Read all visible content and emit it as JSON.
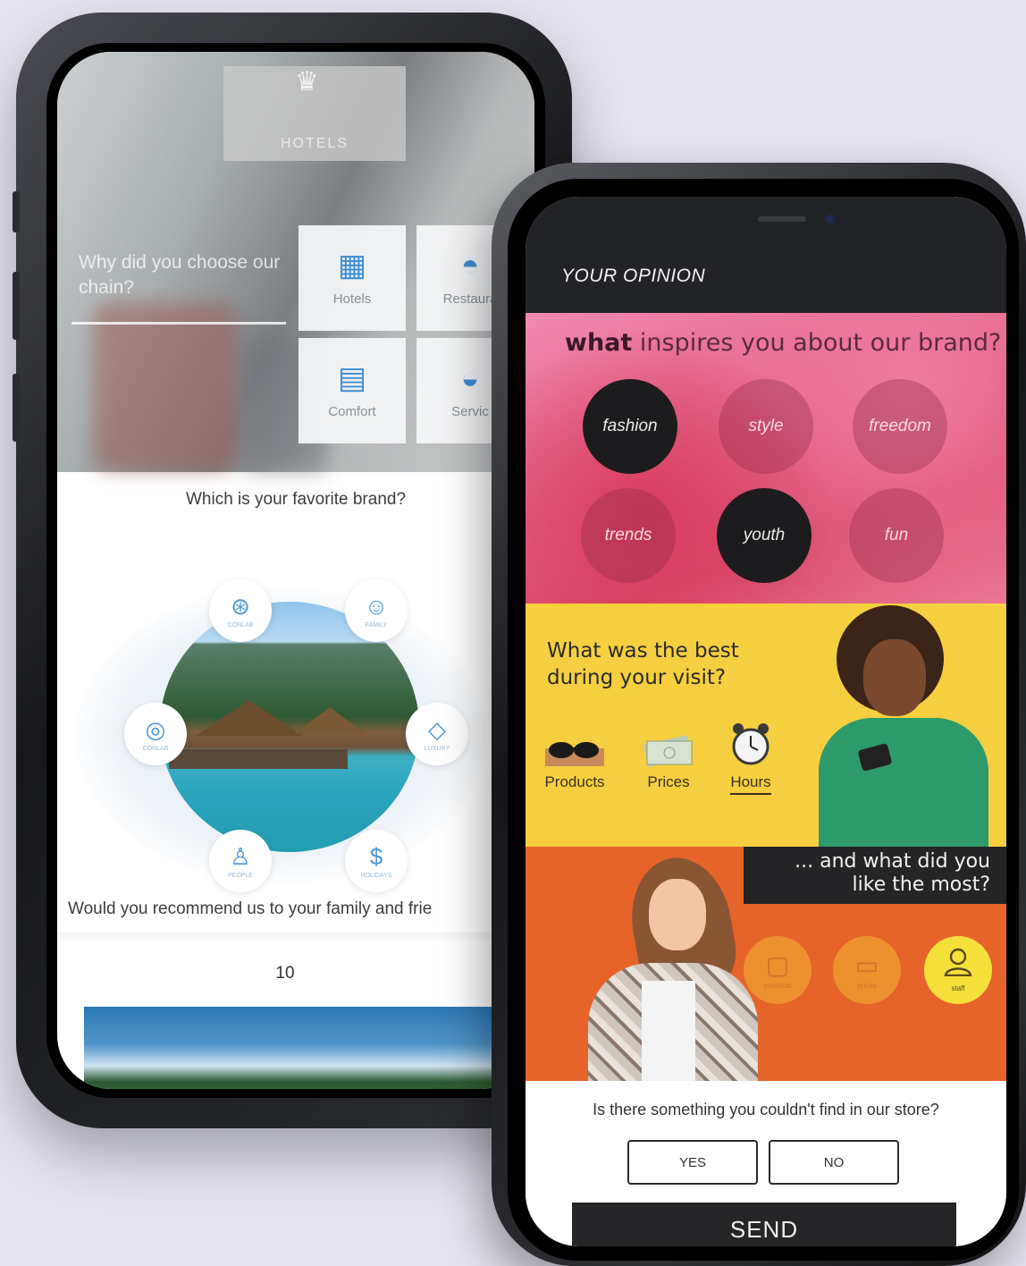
{
  "back_phone": {
    "logo_text": "HOTELS",
    "why_question": "Why did you choose our chain?",
    "options": [
      {
        "label": "Hotels",
        "icon": "building-icon"
      },
      {
        "label": "Restaura",
        "icon": "food-tray-icon"
      },
      {
        "label": "Comfort",
        "icon": "bed-icon"
      },
      {
        "label": "Servic",
        "icon": "service-bell-icon"
      }
    ],
    "brand_question": "Which is your favorite brand?",
    "brand_icons": [
      {
        "icon": "badge-icon",
        "label": "CONLAB"
      },
      {
        "icon": "face-icon",
        "label": "FAMILY"
      },
      {
        "icon": "glasses-icon",
        "label": "CONLAB"
      },
      {
        "icon": "diamond-icon",
        "label": "LUXURY"
      },
      {
        "icon": "person-icon",
        "label": "PEOPLE"
      },
      {
        "icon": "money-icon",
        "label": "HOLIDAYS"
      }
    ],
    "recommend_question": "Would you recommend us to your family and frie",
    "score": "10"
  },
  "front_phone": {
    "header_title": "YOUR OPINION",
    "inspire_question_bold": "what",
    "inspire_question_rest": " inspires you about our brand?",
    "bubbles": [
      {
        "label": "fashion",
        "selected": true
      },
      {
        "label": "style",
        "selected": false
      },
      {
        "label": "freedom",
        "selected": false
      },
      {
        "label": "trends",
        "selected": false
      },
      {
        "label": "youth",
        "selected": true
      },
      {
        "label": "fun",
        "selected": false
      }
    ],
    "best_question_line1": "What was the best",
    "best_question_line2": "during your visit?",
    "best_options": [
      {
        "label": "Products",
        "icon": "sunglasses-icon",
        "selected": false
      },
      {
        "label": "Prices",
        "icon": "banknotes-icon",
        "selected": false
      },
      {
        "label": "Hours",
        "icon": "alarm-clock-icon",
        "selected": true
      }
    ],
    "like_question_line1": "... and what did you",
    "like_question_line2": "like the most?",
    "like_options": [
      {
        "label": "products",
        "icon": "bags-icon",
        "selected": false
      },
      {
        "label": "prices",
        "icon": "cash-icon",
        "selected": false
      },
      {
        "label": "staff",
        "icon": "user-icon",
        "selected": true
      }
    ],
    "store_question": "Is there something you couldn't find in our store?",
    "yes_label": "YES",
    "no_label": "NO",
    "send_label": "SEND"
  },
  "colors": {
    "background": "#e4e3ee",
    "pink_section": "#e25d84",
    "yellow_section": "#f5cf3f",
    "orange_section": "#e6642a",
    "dark": "#222326",
    "accent_blue": "#3b8fd6"
  }
}
